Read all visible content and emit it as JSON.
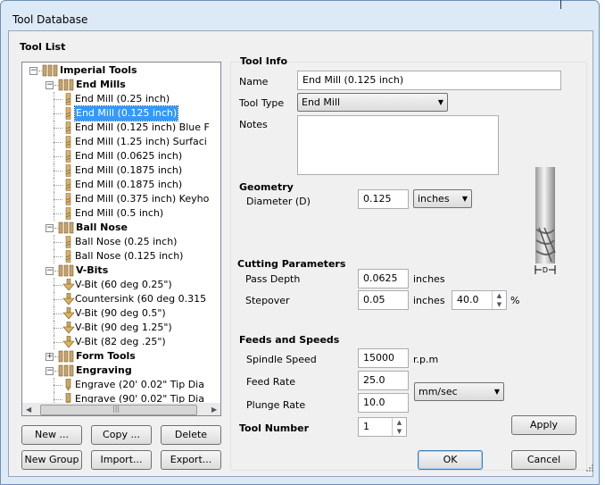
{
  "window": {
    "title": "Tool Database"
  },
  "tool_list": {
    "heading": "Tool List",
    "tree": [
      {
        "label": "Imperial Tools",
        "level": 0,
        "bold": true,
        "expanded": true,
        "icon": "tool-group-icon"
      },
      {
        "label": "End Mills",
        "level": 1,
        "bold": true,
        "expanded": true,
        "icon": "tool-group-icon"
      },
      {
        "label": "End Mill (0.25 inch)",
        "level": 2,
        "icon": "end-mill-icon"
      },
      {
        "label": "End Mill (0.125 inch)",
        "level": 2,
        "icon": "end-mill-icon",
        "selected": true
      },
      {
        "label": "End Mill (0.125 inch) Blue F",
        "level": 2,
        "icon": "end-mill-icon"
      },
      {
        "label": "End Mill (1.25 inch) Surfaci",
        "level": 2,
        "icon": "end-mill-icon"
      },
      {
        "label": "End Mill (0.0625 inch)",
        "level": 2,
        "icon": "end-mill-icon"
      },
      {
        "label": "End Mill (0.1875 inch)",
        "level": 2,
        "icon": "end-mill-icon"
      },
      {
        "label": "End Mill (0.1875 inch)",
        "level": 2,
        "icon": "end-mill-icon"
      },
      {
        "label": "End Mill (0.375 inch) Keyho",
        "level": 2,
        "icon": "end-mill-icon"
      },
      {
        "label": "End Mill (0.5 inch)",
        "level": 2,
        "icon": "end-mill-icon"
      },
      {
        "label": "Ball Nose",
        "level": 1,
        "bold": true,
        "expanded": true,
        "icon": "tool-group-icon"
      },
      {
        "label": "Ball Nose (0.25 inch)",
        "level": 2,
        "icon": "end-mill-icon"
      },
      {
        "label": "Ball Nose (0.125 inch)",
        "level": 2,
        "icon": "end-mill-icon"
      },
      {
        "label": "V-Bits",
        "level": 1,
        "bold": true,
        "expanded": true,
        "icon": "tool-group-icon"
      },
      {
        "label": "V-Bit (60 deg 0.25\")",
        "level": 2,
        "icon": "v-bit-icon"
      },
      {
        "label": "Countersink (60 deg 0.315",
        "level": 2,
        "icon": "v-bit-icon"
      },
      {
        "label": "V-Bit (90 deg 0.5\")",
        "level": 2,
        "icon": "v-bit-icon"
      },
      {
        "label": "V-Bit (90 deg 1.25\")",
        "level": 2,
        "icon": "v-bit-icon"
      },
      {
        "label": "V-Bit (82 deg .25\")",
        "level": 2,
        "icon": "v-bit-icon"
      },
      {
        "label": "Form Tools",
        "level": 1,
        "bold": true,
        "expanded": false,
        "icon": "tool-group-icon"
      },
      {
        "label": "Engraving",
        "level": 1,
        "bold": true,
        "expanded": true,
        "icon": "tool-group-icon"
      },
      {
        "label": "Engrave (20' 0.02\" Tip Dia",
        "level": 2,
        "icon": "engrave-icon"
      },
      {
        "label": "Engrave (90' 0.02\" Tip Dia",
        "level": 2,
        "icon": "engrave-icon"
      }
    ],
    "buttons": {
      "new": "New ...",
      "copy": "Copy ...",
      "delete": "Delete",
      "new_group": "New Group",
      "import": "Import...",
      "export": "Export..."
    }
  },
  "tool_info": {
    "heading": "Tool Info",
    "name_label": "Name",
    "name_value": "End Mill (0.125 inch)",
    "type_label": "Tool Type",
    "type_value": "End Mill",
    "notes_label": "Notes",
    "notes_value": ""
  },
  "geometry": {
    "heading": "Geometry",
    "diameter_label": "Diameter (D)",
    "diameter_value": "0.125",
    "units_value": "inches",
    "diagram_label": "D"
  },
  "cutting": {
    "heading": "Cutting Parameters",
    "pass_depth_label": "Pass Depth",
    "pass_depth_value": "0.0625",
    "pass_depth_unit": "inches",
    "stepover_label": "Stepover",
    "stepover_value": "0.05",
    "stepover_unit": "inches",
    "stepover_percent": "40.0",
    "percent_symbol": "%"
  },
  "feeds": {
    "heading": "Feeds and Speeds",
    "spindle_label": "Spindle Speed",
    "spindle_value": "15000",
    "spindle_unit": "r.p.m",
    "feed_label": "Feed Rate",
    "feed_value": "25.0",
    "plunge_label": "Plunge Rate",
    "plunge_value": "10.0",
    "rate_unit": "mm/sec"
  },
  "tool_number": {
    "label": "Tool Number",
    "value": "1"
  },
  "actions": {
    "apply": "Apply",
    "ok": "OK",
    "cancel": "Cancel"
  },
  "colors": {
    "selection": "#3399ff",
    "frame": "#dce9f6",
    "default_button_border": "#3c7fb1"
  }
}
